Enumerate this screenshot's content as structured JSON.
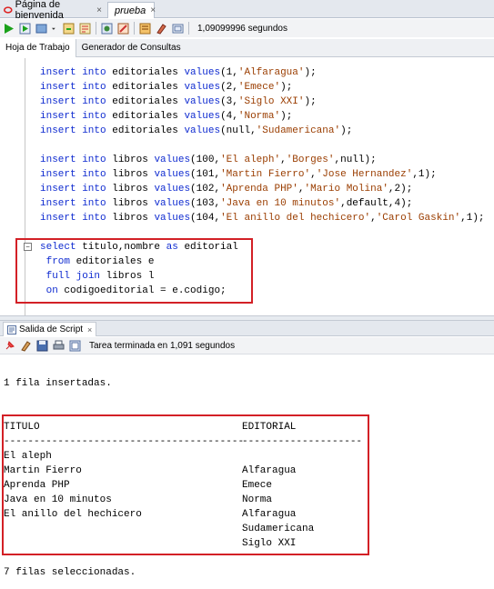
{
  "tabs": [
    {
      "label": "Página de bienvenida",
      "close": "×"
    },
    {
      "label": "prueba",
      "close": "×"
    }
  ],
  "toolbar": {
    "elapsed": "1,09099996 segundos"
  },
  "subtabs": [
    "Hoja de Trabajo",
    "Generador de Consultas"
  ],
  "editor": {
    "lines": [
      {
        "pre": "insert into ",
        "table": "editoriales",
        "mid": " values(",
        "args": "1,'Alfaragua'",
        "end": ");"
      },
      {
        "pre": "insert into ",
        "table": "editoriales",
        "mid": " values(",
        "args": "2,'Emece'",
        "end": ");"
      },
      {
        "pre": "insert into ",
        "table": "editoriales",
        "mid": " values(",
        "args": "3,'Siglo XXI'",
        "end": ");"
      },
      {
        "pre": "insert into ",
        "table": "editoriales",
        "mid": " values(",
        "args": "4,'Norma'",
        "end": ");"
      },
      {
        "pre": "insert into ",
        "table": "editoriales",
        "mid": " values(",
        "args": "null,'Sudamericana'",
        "end": ");"
      }
    ],
    "book_lines": [
      "insert into libros values(100,'El aleph','Borges',null);",
      "insert into libros values(101,'Martin Fierro','Jose Hernandez',1);",
      "insert into libros values(102,'Aprenda PHP','Mario Molina',2);",
      "insert into libros values(103,'Java en 10 minutos',default,4);",
      "insert into libros values(104,'El anillo del hechicero','Carol Gaskin',1);"
    ],
    "query": [
      "select titulo,nombre as editorial",
      " from editoriales e",
      " full join libros l",
      " on codigoeditorial = e.codigo;"
    ]
  },
  "output_tab": {
    "label": "Salida de Script",
    "close": "×"
  },
  "output_status": "Tarea terminada en 1,091 segundos",
  "output": {
    "inserted": "1 fila insertadas.",
    "header_titulo": "TITULO",
    "header_editorial": "EDITORIAL",
    "dash_titulo": "----------------------------------------",
    "dash_editorial": "--------------------",
    "rows": [
      {
        "titulo": "El aleph",
        "editorial": ""
      },
      {
        "titulo": "Martin Fierro",
        "editorial": "Alfaragua"
      },
      {
        "titulo": "Aprenda PHP",
        "editorial": "Emece"
      },
      {
        "titulo": "Java en 10 minutos",
        "editorial": "Norma"
      },
      {
        "titulo": "El anillo del hechicero",
        "editorial": "Alfaragua"
      },
      {
        "titulo": "",
        "editorial": "Sudamericana"
      },
      {
        "titulo": "",
        "editorial": "Siglo XXI"
      }
    ],
    "selected": "7 filas seleccionadas."
  },
  "colors": {
    "keyword": "#0f2bd0",
    "string": "#9a3d00",
    "highlight_box": "#d32026"
  }
}
